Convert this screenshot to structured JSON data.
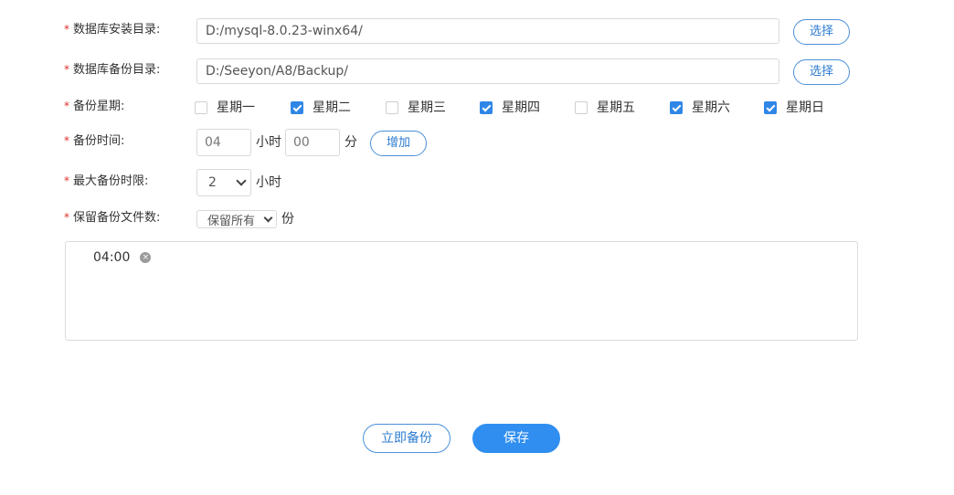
{
  "form": {
    "required_mark": "*",
    "install_dir": {
      "label": "数据库安装目录:",
      "value": "D:/mysql-8.0.23-winx64/",
      "button": "选择"
    },
    "backup_dir": {
      "label": "数据库备份目录:",
      "value": "D:/Seeyon/A8/Backup/",
      "button": "选择"
    },
    "weekdays": {
      "label": "备份星期:",
      "days": [
        {
          "name": "星期一",
          "checked": false
        },
        {
          "name": "星期二",
          "checked": true
        },
        {
          "name": "星期三",
          "checked": false
        },
        {
          "name": "星期四",
          "checked": true
        },
        {
          "name": "星期五",
          "checked": false
        },
        {
          "name": "星期六",
          "checked": true
        },
        {
          "name": "星期日",
          "checked": true
        }
      ]
    },
    "backup_time": {
      "label": "备份时间:",
      "hour": "04",
      "hour_unit": "小时",
      "minute": "00",
      "minute_unit": "分",
      "add_button": "增加"
    },
    "max_duration": {
      "label": "最大备份时限:",
      "value": "2",
      "unit": "小时"
    },
    "keep_files": {
      "label": "保留备份文件数:",
      "value": "保留所有",
      "unit": "份"
    },
    "time_list": [
      {
        "time": "04:00",
        "close_glyph": "×"
      }
    ]
  },
  "footer": {
    "backup_now": "立即备份",
    "save": "保存"
  },
  "colors": {
    "accent": "#2f8ef0",
    "required": "#e0322a",
    "border": "#d9d9d9"
  }
}
